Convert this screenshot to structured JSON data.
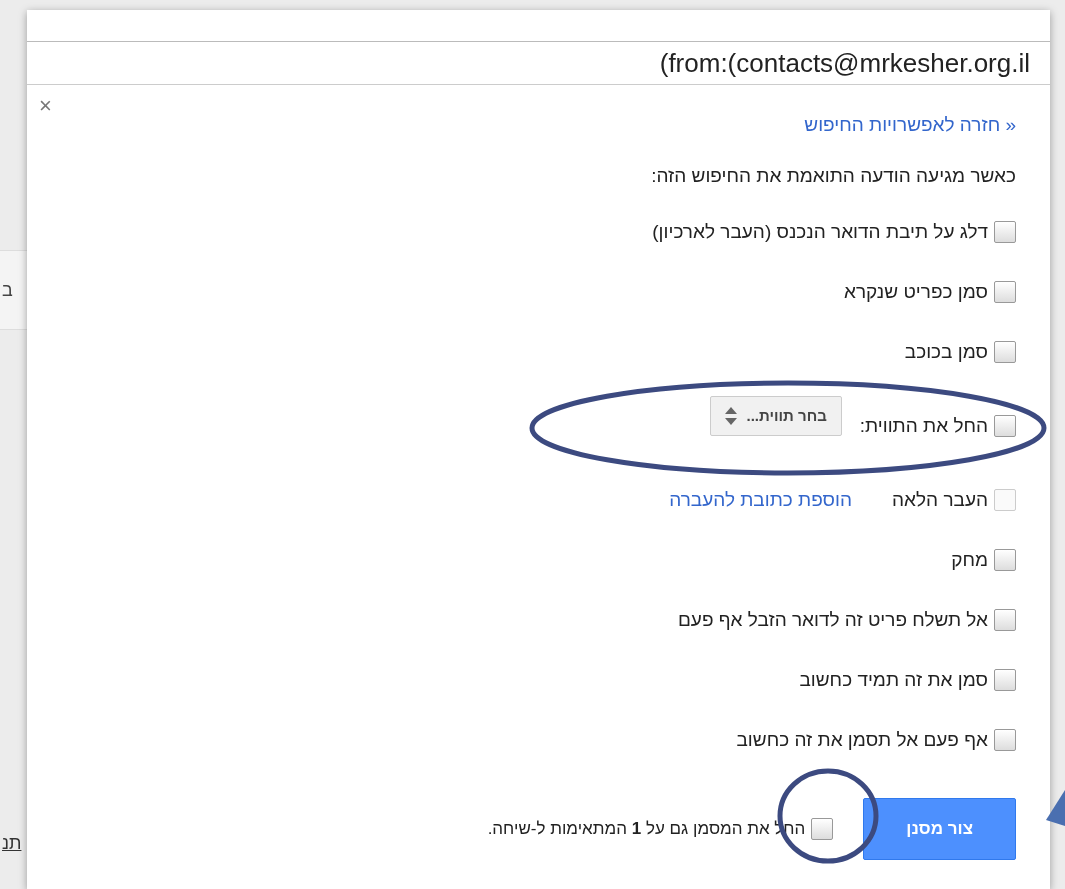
{
  "background_fragments": [
    "ב",
    "תנ"
  ],
  "search": {
    "value": "(from:(contacts@mrkesher.org.il"
  },
  "close": "×",
  "back_link": "« חזרה לאפשרויות החיפוש",
  "intro": "כאשר מגיעה הודעה התואמת את החיפוש הזה:",
  "options": [
    {
      "kind": "checkbox",
      "label": "דלג על תיבת הדואר הנכנס (העבר לארכיון)",
      "checked": false,
      "disabled": false
    },
    {
      "kind": "checkbox",
      "label": "סמן כפריט שנקרא",
      "checked": false,
      "disabled": false
    },
    {
      "kind": "checkbox",
      "label": "סמן בכוכב",
      "checked": false,
      "disabled": false
    },
    {
      "kind": "label",
      "label": "החל את התווית:",
      "select": "בחר תווית...",
      "checked": false,
      "disabled": false
    },
    {
      "kind": "forward",
      "label": "העבר הלאה",
      "link": "הוספת כתובת להעברה",
      "checked": false,
      "disabled": true
    },
    {
      "kind": "checkbox",
      "label": "מחק",
      "checked": false,
      "disabled": false
    },
    {
      "kind": "checkbox",
      "label": "אל תשלח פריט זה לדואר הזבל אף פעם",
      "checked": false,
      "disabled": false
    },
    {
      "kind": "checkbox",
      "label": "סמן את זה תמיד כחשוב",
      "checked": false,
      "disabled": false
    },
    {
      "kind": "checkbox",
      "label": "אף פעם אל תסמן את זה כחשוב",
      "checked": false,
      "disabled": false
    }
  ],
  "also_apply": {
    "text": "החל את המסמן גם על **1** המתאימות ל-שיחה.",
    "checked": false
  },
  "create_button": "צור מסנן"
}
